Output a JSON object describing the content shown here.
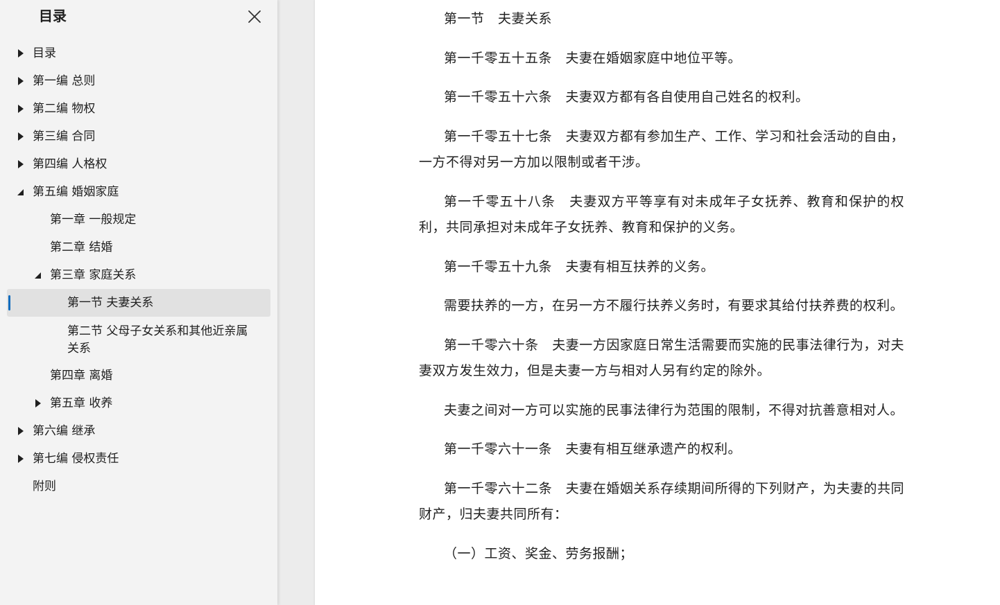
{
  "sidebar": {
    "title": "目录",
    "items": [
      {
        "label": "目录",
        "state": "collapsed"
      },
      {
        "label": "第一编 总则",
        "state": "collapsed"
      },
      {
        "label": "第二编 物权",
        "state": "collapsed"
      },
      {
        "label": "第三编 合同",
        "state": "collapsed"
      },
      {
        "label": "第四编 人格权",
        "state": "collapsed"
      },
      {
        "label": "第五编 婚姻家庭",
        "state": "expanded"
      },
      {
        "label": "第一章 一般规定"
      },
      {
        "label": "第二章 结婚"
      },
      {
        "label": "第三章 家庭关系",
        "state": "expanded"
      },
      {
        "label": "第一节 夫妻关系",
        "selected": true
      },
      {
        "label": "第二节 父母子女关系和其他近亲属关系"
      },
      {
        "label": "第四章 离婚"
      },
      {
        "label": "第五章 收养",
        "state": "collapsed"
      },
      {
        "label": "第六编 继承",
        "state": "collapsed"
      },
      {
        "label": "第七编 侵权责任",
        "state": "collapsed"
      },
      {
        "label": "附则"
      }
    ]
  },
  "document": {
    "paragraphs": [
      "第一节　夫妻关系",
      "第一千零五十五条　夫妻在婚姻家庭中地位平等。",
      "第一千零五十六条　夫妻双方都有各自使用自己姓名的权利。",
      "第一千零五十七条　夫妻双方都有参加生产、工作、学习和社会活动的自由，一方不得对另一方加以限制或者干涉。",
      "第一千零五十八条　夫妻双方平等享有对未成年子女抚养、教育和保护的权利，共同承担对未成年子女抚养、教育和保护的义务。",
      "第一千零五十九条　夫妻有相互扶养的义务。",
      "需要扶养的一方，在另一方不履行扶养义务时，有要求其给付扶养费的权利。",
      "第一千零六十条　夫妻一方因家庭日常生活需要而实施的民事法律行为，对夫妻双方发生效力，但是夫妻一方与相对人另有约定的除外。",
      "夫妻之间对一方可以实施的民事法律行为范围的限制，不得对抗善意相对人。",
      "第一千零六十一条　夫妻有相互继承遗产的权利。",
      "第一千零六十二条　夫妻在婚姻关系存续期间所得的下列财产，为夫妻的共同财产，归夫妻共同所有：",
      "（一）工资、奖金、劳务报酬；"
    ]
  },
  "colors": {
    "accent": "#0f6cbd",
    "selected_bg": "#e1e1e1",
    "sidebar_bg": "#f3f3f3"
  },
  "icons": {
    "close": "close-icon",
    "collapsed": "caret-right-icon",
    "expanded": "caret-down-right-icon"
  }
}
